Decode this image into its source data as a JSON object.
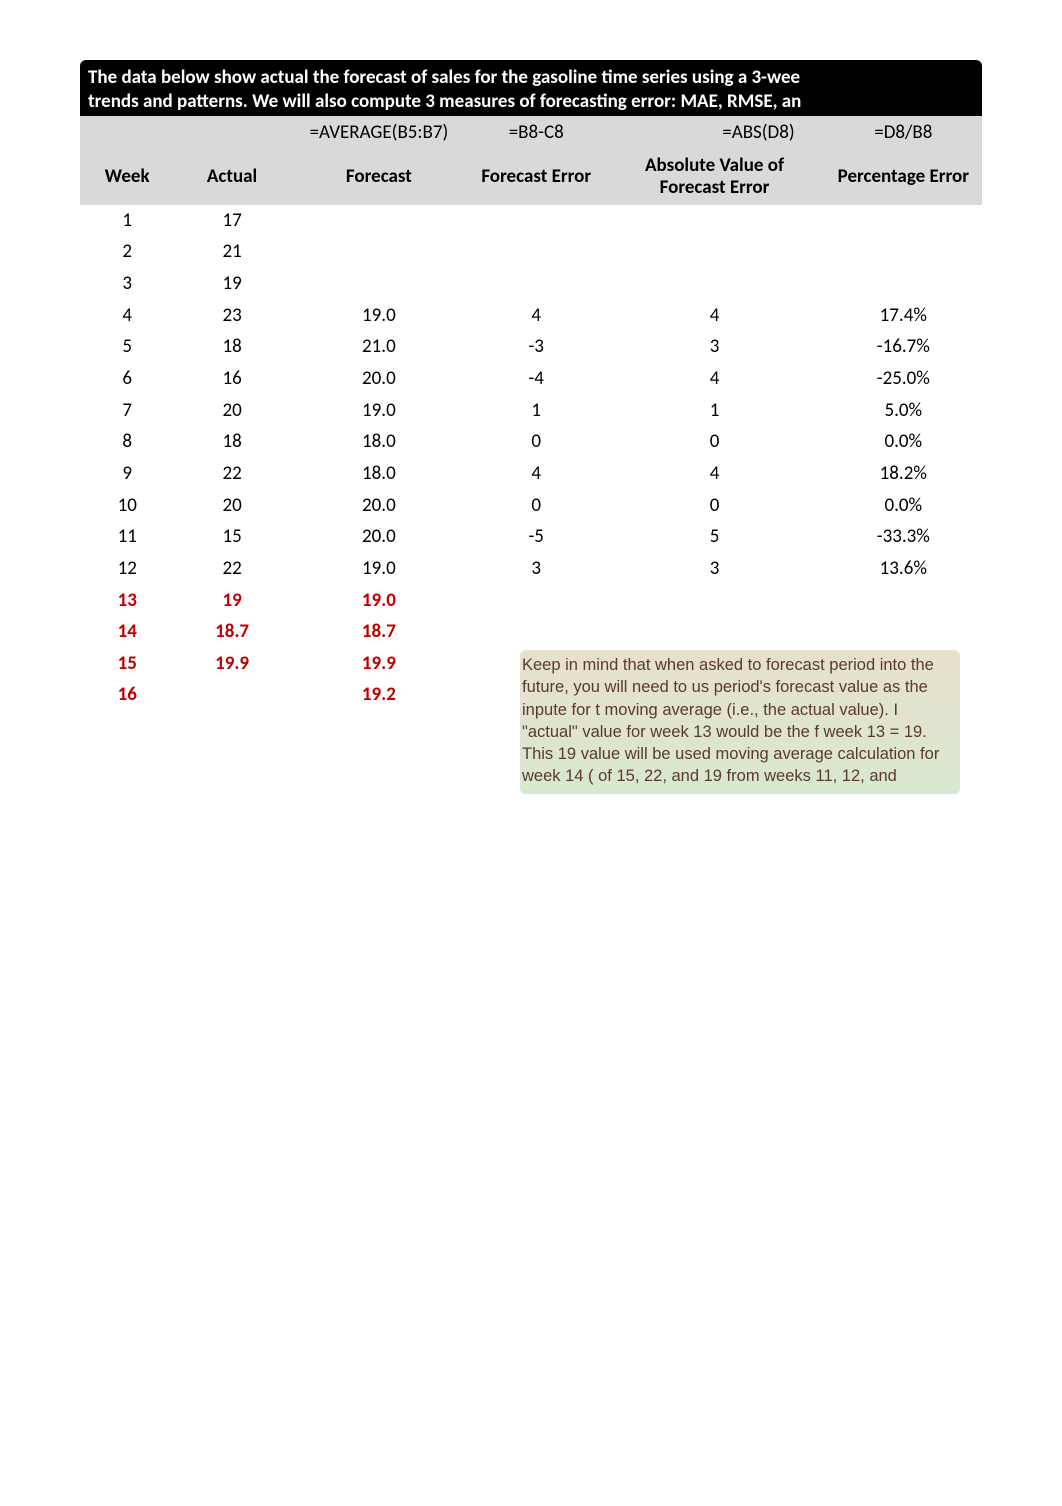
{
  "banner": {
    "line1": "The data below show actual the forecast of sales for the gasoline time series using a 3-wee",
    "line2": "trends and patterns.  We will also compute 3 measures of forecasting error: MAE, RMSE, an"
  },
  "formulas": {
    "forecast": "=AVERAGE(B5:B7)",
    "ferr": "=B8-C8",
    "abs": "=ABS(D8)",
    "perr": "=D8/B8"
  },
  "headers": {
    "week": "Week",
    "actual": "Actual",
    "forecast": "Forecast",
    "ferr": "Forecast Error",
    "abs": "Absolute Value of Forecast Error",
    "perr": "Percentage Error"
  },
  "rows": [
    {
      "week": "1",
      "actual": "17",
      "forecast": "",
      "ferr": "",
      "abs": "",
      "perr": "",
      "red": false
    },
    {
      "week": "2",
      "actual": "21",
      "forecast": "",
      "ferr": "",
      "abs": "",
      "perr": "",
      "red": false
    },
    {
      "week": "3",
      "actual": "19",
      "forecast": "",
      "ferr": "",
      "abs": "",
      "perr": "",
      "red": false
    },
    {
      "week": "4",
      "actual": "23",
      "forecast": "19.0",
      "ferr": "4",
      "abs": "4",
      "perr": "17.4%",
      "red": false
    },
    {
      "week": "5",
      "actual": "18",
      "forecast": "21.0",
      "ferr": "-3",
      "abs": "3",
      "perr": "-16.7%",
      "red": false
    },
    {
      "week": "6",
      "actual": "16",
      "forecast": "20.0",
      "ferr": "-4",
      "abs": "4",
      "perr": "-25.0%",
      "red": false
    },
    {
      "week": "7",
      "actual": "20",
      "forecast": "19.0",
      "ferr": "1",
      "abs": "1",
      "perr": "5.0%",
      "red": false
    },
    {
      "week": "8",
      "actual": "18",
      "forecast": "18.0",
      "ferr": "0",
      "abs": "0",
      "perr": "0.0%",
      "red": false
    },
    {
      "week": "9",
      "actual": "22",
      "forecast": "18.0",
      "ferr": "4",
      "abs": "4",
      "perr": "18.2%",
      "red": false
    },
    {
      "week": "10",
      "actual": "20",
      "forecast": "20.0",
      "ferr": "0",
      "abs": "0",
      "perr": "0.0%",
      "red": false
    },
    {
      "week": "11",
      "actual": "15",
      "forecast": "20.0",
      "ferr": "-5",
      "abs": "5",
      "perr": "-33.3%",
      "red": false
    },
    {
      "week": "12",
      "actual": "22",
      "forecast": "19.0",
      "ferr": "3",
      "abs": "3",
      "perr": "13.6%",
      "red": false
    },
    {
      "week": "13",
      "actual": "19",
      "forecast": "19.0",
      "ferr": "",
      "abs": "",
      "perr": "",
      "red": true
    },
    {
      "week": "14",
      "actual": "18.7",
      "forecast": "18.7",
      "ferr": "",
      "abs": "",
      "perr": "",
      "red": true
    },
    {
      "week": "15",
      "actual": "19.9",
      "forecast": "19.9",
      "ferr": "",
      "abs": "",
      "perr": "",
      "red": true
    },
    {
      "week": "16",
      "actual": "",
      "forecast": "19.2",
      "ferr": "",
      "abs": "",
      "perr": "",
      "red": true
    }
  ],
  "note": "Keep in mind that when asked to forecast period into the future, you will need to us period's forecast value as the inpute for t moving average (i.e., the actual value).  I \"actual\" value for week 13 would be the f week 13 = 19.  This 19 value will be used moving average calculation for week 14 ( of 15, 22, and 19 from weeks 11, 12, and",
  "chart_data": {
    "type": "table",
    "title": "3-Week Moving Average Forecast — Gasoline Time Series",
    "columns": [
      "Week",
      "Actual",
      "Forecast",
      "Forecast Error",
      "Absolute Value of Forecast Error",
      "Percentage Error"
    ],
    "rows": [
      [
        1,
        17,
        null,
        null,
        null,
        null
      ],
      [
        2,
        21,
        null,
        null,
        null,
        null
      ],
      [
        3,
        19,
        null,
        null,
        null,
        null
      ],
      [
        4,
        23,
        19.0,
        4,
        4,
        0.174
      ],
      [
        5,
        18,
        21.0,
        -3,
        3,
        -0.167
      ],
      [
        6,
        16,
        20.0,
        -4,
        4,
        -0.25
      ],
      [
        7,
        20,
        19.0,
        1,
        1,
        0.05
      ],
      [
        8,
        18,
        18.0,
        0,
        0,
        0.0
      ],
      [
        9,
        22,
        18.0,
        4,
        4,
        0.182
      ],
      [
        10,
        20,
        20.0,
        0,
        0,
        0.0
      ],
      [
        11,
        15,
        20.0,
        -5,
        5,
        -0.333
      ],
      [
        12,
        22,
        19.0,
        3,
        3,
        0.136
      ],
      [
        13,
        19,
        19.0,
        null,
        null,
        null
      ],
      [
        14,
        18.7,
        18.7,
        null,
        null,
        null
      ],
      [
        15,
        19.9,
        19.9,
        null,
        null,
        null
      ],
      [
        16,
        null,
        19.2,
        null,
        null,
        null
      ]
    ]
  }
}
